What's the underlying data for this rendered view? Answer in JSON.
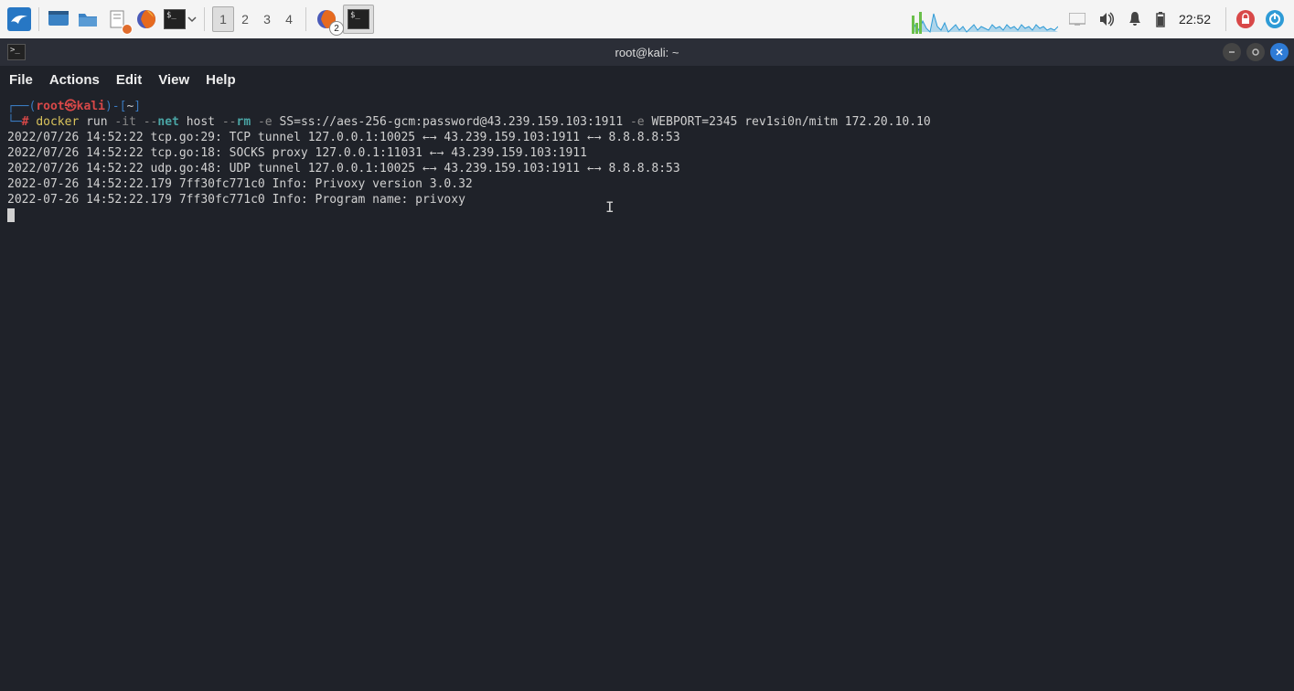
{
  "taskbar": {
    "workspaces": [
      "1",
      "2",
      "3",
      "4"
    ],
    "active_workspace": 0,
    "firefox_badge": "2",
    "clock": "22:52"
  },
  "window": {
    "title": "root@kali: ~",
    "menus": [
      "File",
      "Actions",
      "Edit",
      "View",
      "Help"
    ]
  },
  "prompt": {
    "open": "┌──(",
    "user": "root",
    "at": "㉿",
    "host": "kali",
    "close": ")-[",
    "cwd": "~",
    "end": "]",
    "line2_prefix": "└─",
    "hash": "#"
  },
  "command": {
    "c1": "docker",
    "c2": " run ",
    "c3": "-it",
    "c4": " --",
    "c5": "net",
    "c6": " host ",
    "c7": "--",
    "c8": "rm ",
    "c9": "-e",
    "c10": " SS=ss://aes-256-gcm:password@43.239.159.103:1911 ",
    "c11": "-e",
    "c12": " WEBPORT=2345 rev1si0n/mitm 172.20.10.10"
  },
  "output": {
    "l1": "2022/07/26 14:52:22 tcp.go:29: TCP tunnel 127.0.0.1:10025 ←→ 43.239.159.103:1911 ←→ 8.8.8.8:53",
    "l2": "2022/07/26 14:52:22 tcp.go:18: SOCKS proxy 127.0.0.1:11031 ←→ 43.239.159.103:1911",
    "l3": "2022/07/26 14:52:22 udp.go:48: UDP tunnel 127.0.0.1:10025 ←→ 43.239.159.103:1911 ←→ 8.8.8.8:53",
    "l4": "2022-07-26 14:52:22.179 7ff30fc771c0 Info: Privoxy version 3.0.32",
    "l5": "2022-07-26 14:52:22.179 7ff30fc771c0 Info: Program name: privoxy"
  }
}
